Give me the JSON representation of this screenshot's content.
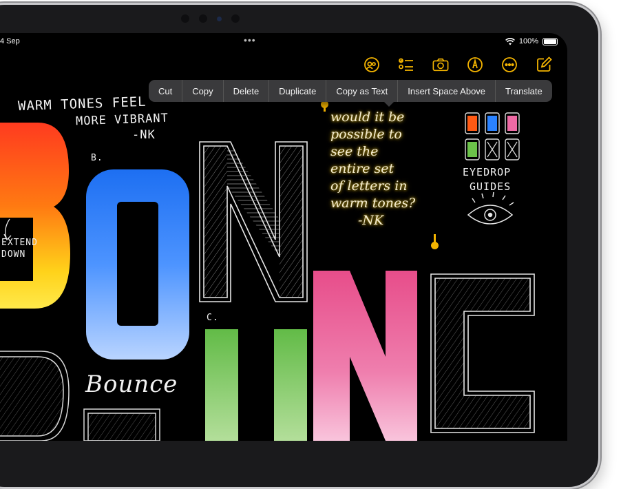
{
  "status_bar": {
    "time": "4 Sep",
    "more": "•••",
    "battery": "100%"
  },
  "toolbar": {
    "icons": [
      "collaborate-icon",
      "checklist-icon",
      "camera-icon",
      "markup-pen-icon",
      "more-icon",
      "compose-icon"
    ],
    "accent": "#f4b400"
  },
  "context_menu": {
    "items": [
      "Cut",
      "Copy",
      "Delete",
      "Duplicate",
      "Copy as Text",
      "Insert Space Above",
      "Translate"
    ]
  },
  "canvas": {
    "note_top_1": "WARM TONES FEEL",
    "note_top_2": "MORE VIBRANT",
    "note_top_3": "-NK",
    "label_b": "B.",
    "label_c": "C.",
    "note_left_1": "EXTEND",
    "note_left_2": "DOWN",
    "highlighted_note": [
      "would it be",
      "possible to",
      "see the",
      "entire set",
      "of letters in",
      "warm tones?",
      "-NK"
    ],
    "eyedrop_1": "EYEDROP",
    "eyedrop_2": "GUIDES",
    "bounce": "Bounce"
  }
}
